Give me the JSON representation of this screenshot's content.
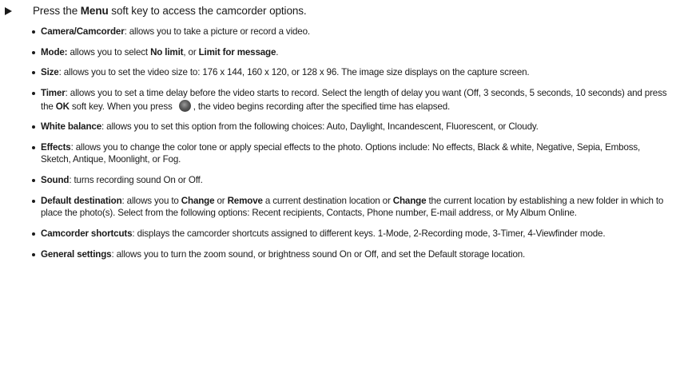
{
  "intro": {
    "before": "Press the ",
    "key": "Menu",
    "after": " soft key to access the camcorder options."
  },
  "options": [
    {
      "term": "Camera/Camcorder",
      "sep": ": ",
      "desc": "allows you to take a picture or record a video."
    },
    {
      "term": "Mode:",
      "desc": " allows you to select ",
      "b1": "No limit",
      "mid": ", or ",
      "b2": "Limit for message",
      "end": "."
    },
    {
      "term": "Size",
      "desc": ": allows you to set the video size to: 176 x 144, 160 x 120, or 128 x 96. The image size displays on the capture screen."
    },
    {
      "term": "Timer",
      "desc": ": allows you to set a time delay before the video starts to record. Select the length of delay you want (Off, 3 seconds, 5 seconds, 10 seconds) and press the ",
      "b1": "OK",
      "mid": " soft key. When you press ",
      "icon": "camera-key-icon",
      "end": ", the video begins recording after the specified time has elapsed."
    },
    {
      "term": "White balance",
      "desc": ": allows you to set this option from the following choices: Auto, Daylight, Incandescent, Fluorescent, or Cloudy."
    },
    {
      "term": "Effects",
      "desc": ": allows you to change the color tone or apply special effects to the photo. Options include: No effects, Black & white, Negative, Sepia, Emboss, Sketch, Antique, Moonlight, or Fog."
    },
    {
      "term": "Sound",
      "desc": ": turns recording sound On or Off."
    },
    {
      "term": "Default destination",
      "desc": ": allows you to ",
      "b1": "Change",
      "mid": " or ",
      "b2": "Remove",
      "mid2": " a current destination location or ",
      "b3": "Change",
      "end": " the current location by establishing a new folder in which to place the photo(s). Select from the following options: Recent recipients, Contacts, Phone number, E-mail address, or My Album Online."
    },
    {
      "term": "Camcorder shortcuts",
      "desc": ": displays the camcorder shortcuts assigned to different keys. 1-Mode, 2-Recording mode, 3-Timer, 4-Viewfinder mode."
    },
    {
      "term": "General settings",
      "desc": ": allows you to turn the zoom sound, or brightness sound On or Off, and set the Default storage location."
    }
  ]
}
